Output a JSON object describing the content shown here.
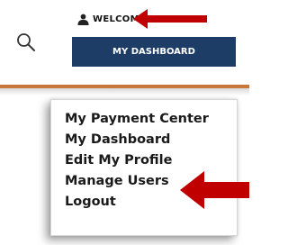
{
  "header": {
    "welcome_label": "WELCOME",
    "dashboard_button": "MY DASHBOARD"
  },
  "icons": {
    "search": "search-icon",
    "user": "user-icon"
  },
  "menu": {
    "items": [
      {
        "label": "My Payment Center"
      },
      {
        "label": "My Dashboard"
      },
      {
        "label": "Edit My Profile"
      },
      {
        "label": "Manage Users"
      },
      {
        "label": "Logout"
      }
    ]
  },
  "colors": {
    "dashboard_button_bg": "#1e3d66",
    "accent_bar": "#c8783c",
    "arrow": "#c00000"
  }
}
